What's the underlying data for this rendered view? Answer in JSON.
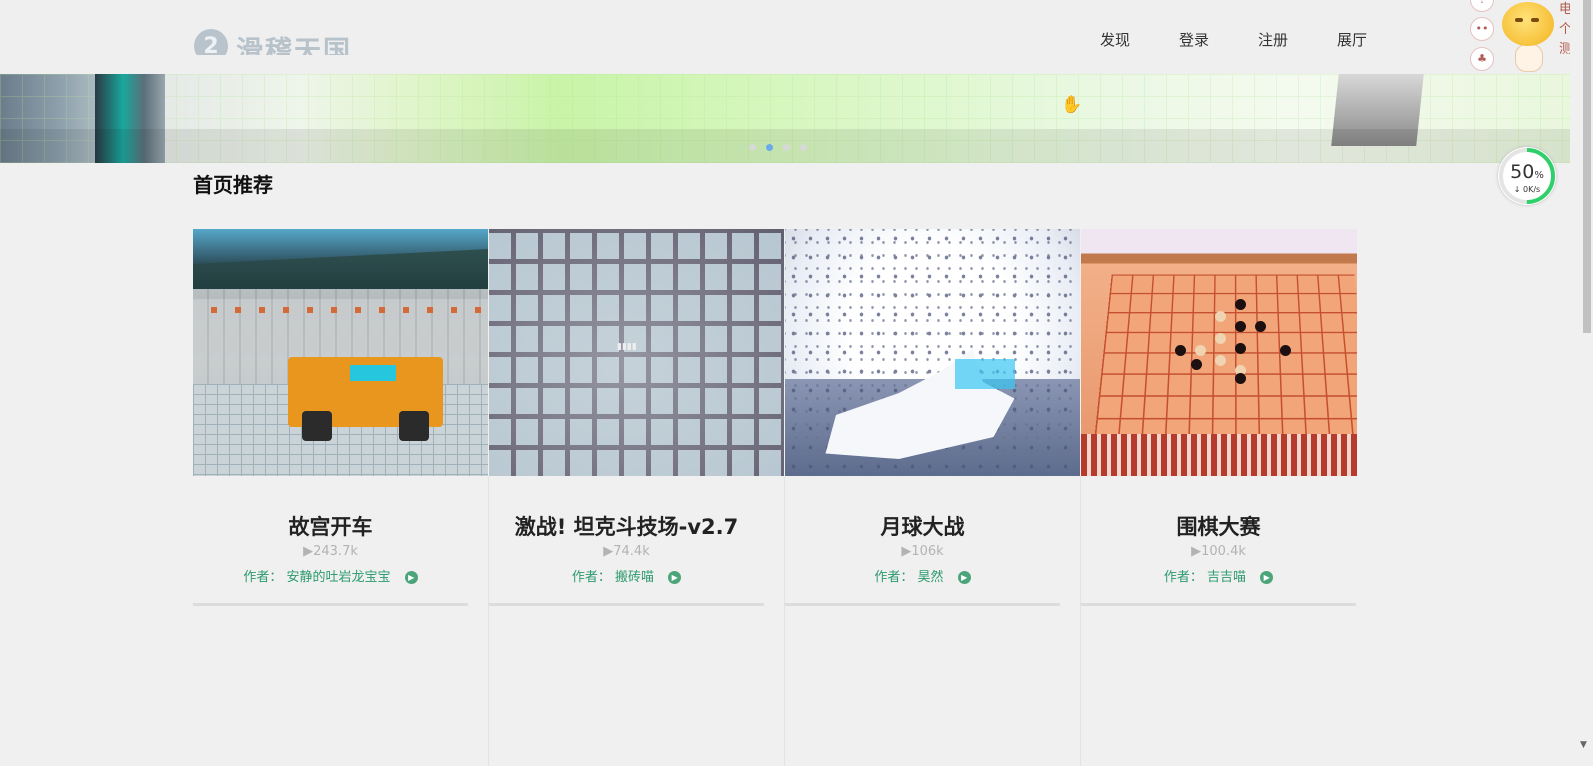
{
  "header": {
    "logo_text": "滑稽天国",
    "nav": [
      "发现",
      "登录",
      "注册",
      "展厅"
    ]
  },
  "banner": {
    "slide_count": 4,
    "active_slide": 1
  },
  "section": {
    "title": "首页推荐"
  },
  "cards": [
    {
      "title": "故宫开车",
      "plays": "▶243.7k",
      "author_label": "作者：",
      "author": "安静的吐岩龙宝宝"
    },
    {
      "title": "激战! 坦克斗技场-v2.7",
      "plays": "▶74.4k",
      "author_label": "作者：",
      "author": "搬砖喵"
    },
    {
      "title": "月球大战",
      "plays": "▶106k",
      "author_label": "作者：",
      "author": "昊然"
    },
    {
      "title": "围棋大赛",
      "plays": "▶100.4k",
      "author_label": "作者：",
      "author": "吉吉喵"
    }
  ],
  "speed_widget": {
    "percent": "50",
    "unit": "%",
    "rate": "↓ 0K/s"
  },
  "side_text": "电个测",
  "colors": {
    "accent_green": "#2c9a6e",
    "active_dot": "#6aa9ea"
  }
}
